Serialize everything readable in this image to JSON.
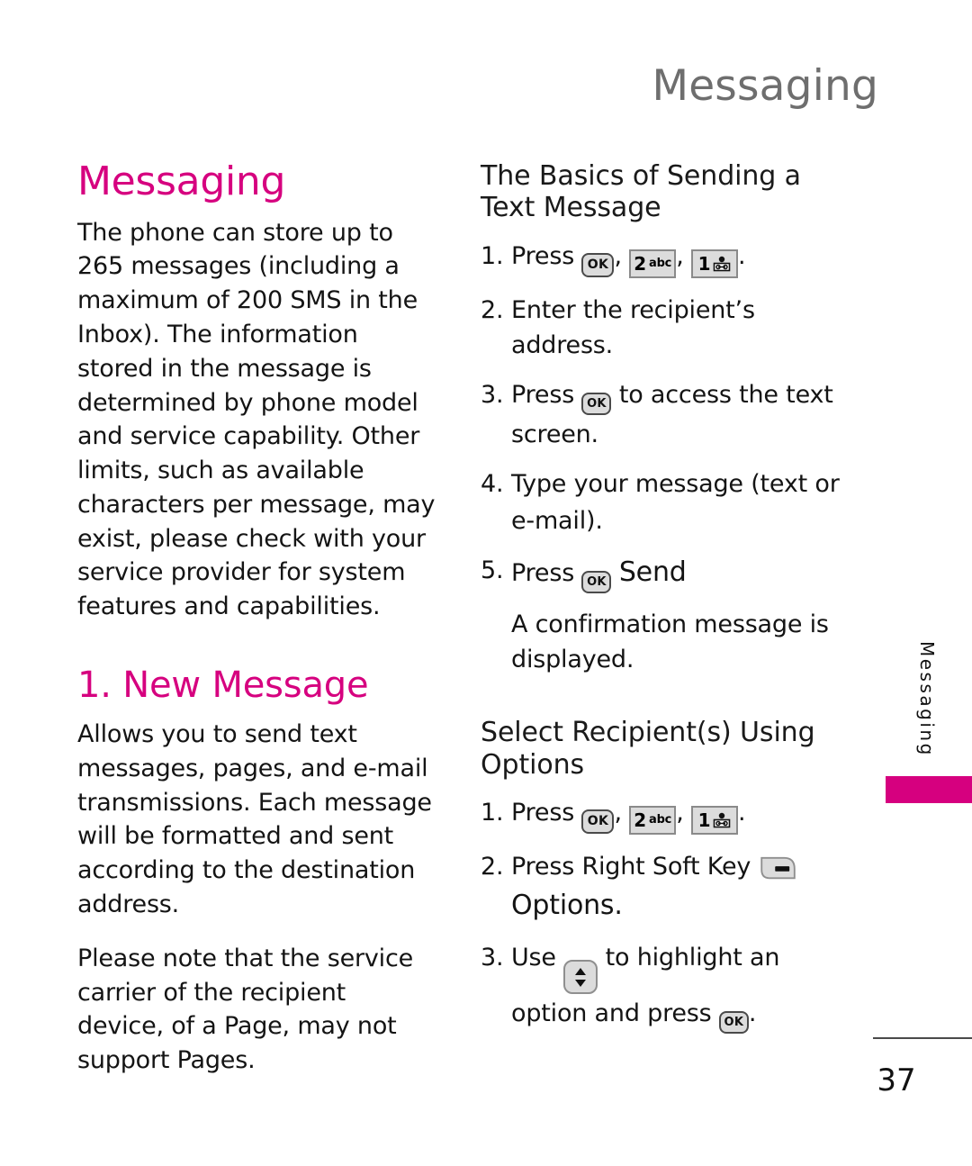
{
  "header": {
    "running_title": "Messaging"
  },
  "side_tab": {
    "label": "Messaging",
    "accent_color": "#d6007f"
  },
  "footer": {
    "page_number": "37"
  },
  "colors": {
    "heading_magenta": "#d6007f",
    "running_header_gray": "#6e6e6e",
    "body_text": "#141414"
  },
  "left_column": {
    "title": "Messaging",
    "intro_paragraph": "The phone can store up to 265 messages (including a maximum of 200 SMS in the Inbox). The information stored in the message is determined by phone model and service capability. Other limits, such as available characters per message, may exist, please check with your service provider for system features and capabilities.",
    "section_title": "1. New Message",
    "section_paragraph_1": "Allows you to send text messages, pages, and e-mail transmissions. Each message will be formatted and sent according to the destination address.",
    "section_paragraph_2": "Please note that the service carrier of the recipient device, of a Page, may not support Pages."
  },
  "right_column": {
    "block_1": {
      "heading": "The Basics of Sending a Text Message",
      "steps": [
        {
          "number": "1.",
          "pre": "Press",
          "keys": [
            "ok-key",
            "2-abc-key",
            "1-voicemail-key"
          ],
          "post": "."
        },
        {
          "number": "2.",
          "text": "Enter the recipient’s address."
        },
        {
          "number": "3.",
          "pre": "Press",
          "keys": [
            "ok-key"
          ],
          "post": "to access the text",
          "continuation": "screen."
        },
        {
          "number": "4.",
          "text": "Type your message (text or",
          "continuation": "e-mail)."
        },
        {
          "number": "5.",
          "pre": "Press",
          "keys": [
            "ok-key"
          ],
          "post": "Send"
        }
      ],
      "note": "A confirmation message is displayed."
    },
    "block_2": {
      "heading": "Select Recipient(s) Using Options",
      "steps": [
        {
          "number": "1.",
          "pre": "Press",
          "keys": [
            "ok-key",
            "2-abc-key",
            "1-voicemail-key"
          ],
          "post": "."
        },
        {
          "number": "2.",
          "pre": "Press Right Soft Key",
          "keys": [
            "right-soft-key"
          ],
          "continuation": "Options."
        },
        {
          "number": "3.",
          "pre": "Use",
          "keys": [
            "nav-updown-key"
          ],
          "post": "to highlight an",
          "continuation_pre": "option and press",
          "continuation_keys": [
            "ok-key"
          ],
          "continuation_post": "."
        }
      ]
    }
  },
  "keys": {
    "ok": {
      "label": "OK",
      "name": "ok-key"
    },
    "two_abc": {
      "digit": "2",
      "letters": "abc",
      "name": "2-abc-key"
    },
    "one_voicemail": {
      "digit": "1",
      "letters": "",
      "name": "1-voicemail-key"
    },
    "right_soft": {
      "name": "right-soft-key"
    },
    "nav_updown": {
      "name": "nav-updown-key"
    }
  }
}
